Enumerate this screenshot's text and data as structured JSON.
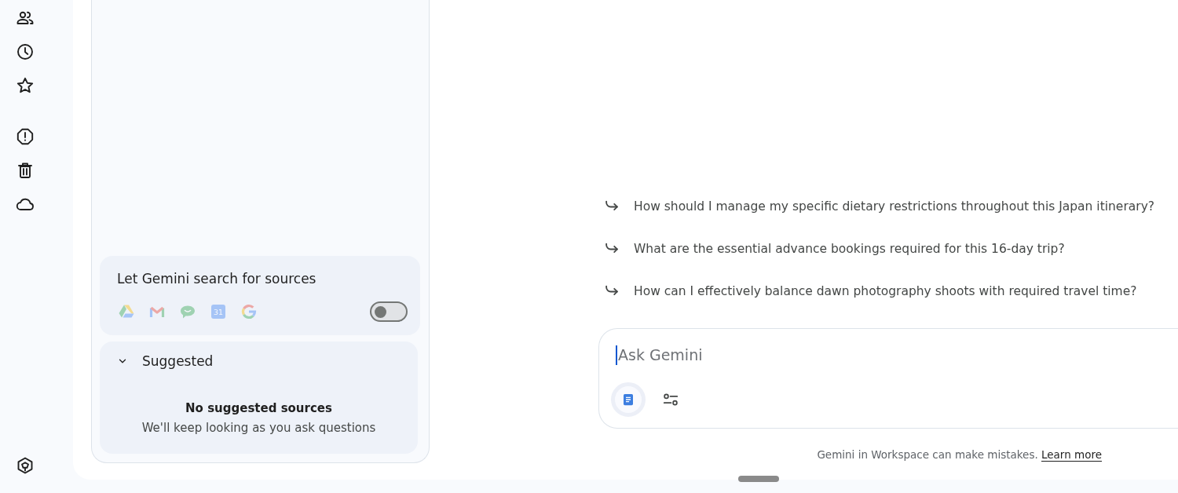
{
  "sources_panel": {
    "search_card": {
      "title": "Let Gemini search for sources",
      "calendar_date": "31",
      "enabled": false
    },
    "suggested": {
      "title": "Suggested",
      "expanded": true,
      "empty_title": "No suggested sources",
      "empty_message": "We'll keep looking as you ask questions"
    }
  },
  "suggested_questions": [
    "How should I manage my specific dietary restrictions throughout this Japan itinerary?",
    "What are the essential advance bookings required for this 16-day trip?",
    "How can I effectively balance dawn photography shoots with required travel time?"
  ],
  "prompt": {
    "placeholder": "Ask Gemini",
    "focused": true
  },
  "disclaimer": {
    "text": "Gemini in Workspace can make mistakes.",
    "link": "Learn more"
  }
}
